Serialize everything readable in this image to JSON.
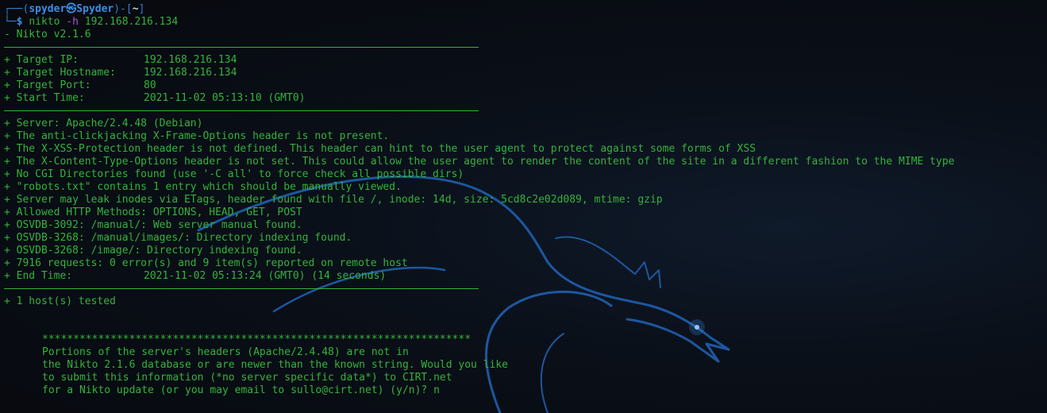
{
  "prompt": {
    "top_prefix": "┌──(",
    "user": "spyder",
    "skull": "㉿",
    "host": "Spyder",
    "bracket_mid": ")-[",
    "cwd": "~",
    "bracket_end": "]",
    "bottom_prefix": "└─",
    "dollar": "$",
    "command": "nikto",
    "flag": "-h",
    "arg": "192.168.216.134"
  },
  "version_line": "- Nikto v2.1.6",
  "target_info": [
    {
      "label": "+ Target IP:",
      "value": "192.168.216.134"
    },
    {
      "label": "+ Target Hostname:",
      "value": "192.168.216.134"
    },
    {
      "label": "+ Target Port:",
      "value": "80"
    },
    {
      "label": "+ Start Time:",
      "value": "2021-11-02 05:13:10 (GMT0)"
    }
  ],
  "findings": [
    "+ Server: Apache/2.4.48 (Debian)",
    "+ The anti-clickjacking X-Frame-Options header is not present.",
    "+ The X-XSS-Protection header is not defined. This header can hint to the user agent to protect against some forms of XSS",
    "+ The X-Content-Type-Options header is not set. This could allow the user agent to render the content of the site in a different fashion to the MIME type",
    "+ No CGI Directories found (use '-C all' to force check all possible dirs)",
    "+ \"robots.txt\" contains 1 entry which should be manually viewed.",
    "+ Server may leak inodes via ETags, header found with file /, inode: 14d, size: 5cd8c2e02d089, mtime: gzip",
    "+ Allowed HTTP Methods: OPTIONS, HEAD, GET, POST",
    "+ OSVDB-3092: /manual/: Web server manual found.",
    "+ OSVDB-3268: /manual/images/: Directory indexing found.",
    "+ OSVDB-3268: /image/: Directory indexing found.",
    "+ 7916 requests: 0 error(s) and 9 item(s) reported on remote host"
  ],
  "end_time": {
    "label": "+ End Time:",
    "value": "2021-11-02 05:13:24 (GMT0) (14 seconds)"
  },
  "hosts_tested": "+ 1 host(s) tested",
  "banner": {
    "stars": "*********************************************************************",
    "lines": [
      "Portions of the server's headers (Apache/2.4.48) are not in",
      "the Nikto 2.1.6 database or are newer than the known string. Would you like",
      "to submit this information (*no server specific data*) to CIRT.net",
      "for a Nikto update (or you may email to sullo@cirt.net) (y/n)? n"
    ]
  },
  "colors": {
    "background": "#0b0e14",
    "output_text": "#34b33a",
    "prompt_blue": "#3b8ee8",
    "flag_purple": "#b04fd0",
    "dragon_glow": "#1f5fae"
  },
  "icons": {
    "wallpaper": "kali-dragon-icon"
  }
}
